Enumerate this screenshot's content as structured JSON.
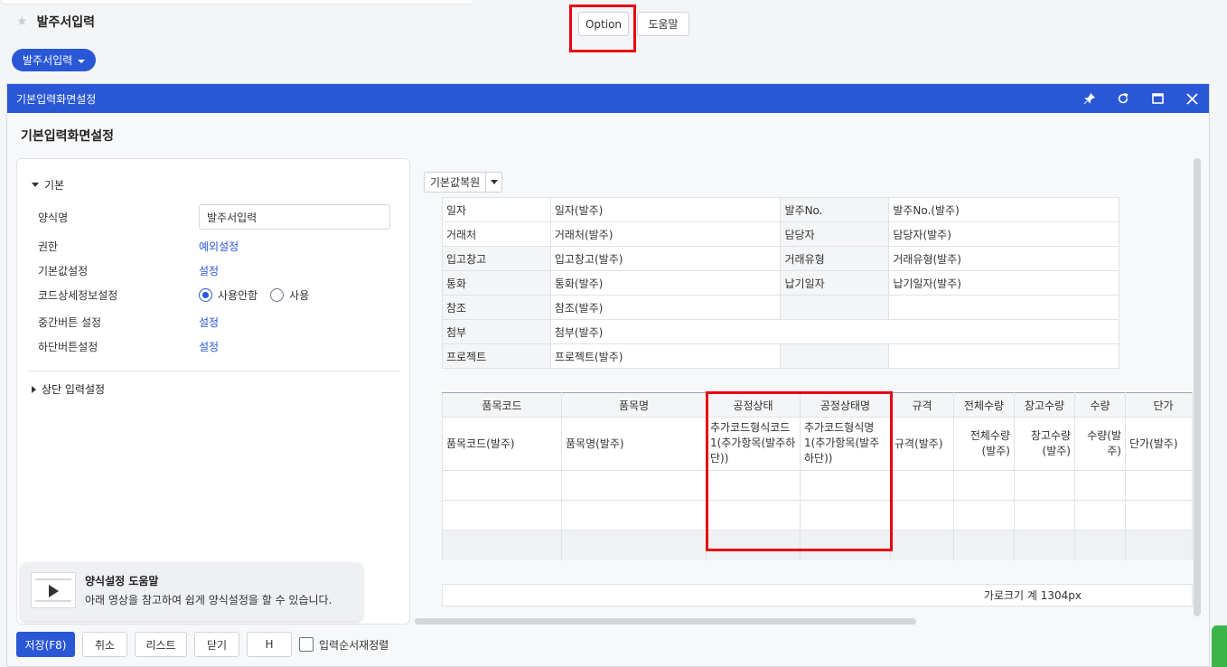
{
  "page": {
    "title": "발주서입력",
    "option_label": "Option",
    "help_label": "도움말",
    "dropdown_label": "발주서입력"
  },
  "modal": {
    "title": "기본입력화면설정",
    "subtitle": "기본입력화면설정",
    "icons": [
      "pin-icon",
      "refresh-icon",
      "maximize-icon",
      "close-icon"
    ]
  },
  "left": {
    "section_basic": "기본",
    "rows": {
      "form_name_label": "양식명",
      "form_name_value": "발주서입력",
      "permission_label": "권한",
      "permission_value": "예외설정",
      "default_label": "기본값설정",
      "default_value": "설정",
      "code_detail_label": "코드상세정보설정",
      "radio_off": "사용안함",
      "radio_on": "사용",
      "mid_button_label": "중간버튼 설정",
      "mid_button_value": "설정",
      "bottom_button_label": "하단버튼설정",
      "bottom_button_value": "설정"
    },
    "section_top": "상단 입력설정",
    "help": {
      "title": "양식설정 도움말",
      "text": "아래 영상을 참고하여 쉽게 양식설정을 할 수 있습니다."
    }
  },
  "right": {
    "reset_label": "기본값복원",
    "header_rows": [
      [
        "일자",
        "일자(발주)",
        "발주No.",
        "발주No.(발주)"
      ],
      [
        "거래처",
        "거래처(발주)",
        "담당자",
        "담당자(발주)"
      ],
      [
        "입고창고",
        "입고창고(발주)",
        "거래유형",
        "거래유형(발주)"
      ],
      [
        "통화",
        "통화(발주)",
        "납기일자",
        "납기일자(발주)"
      ],
      [
        "참조",
        "참조(발주)",
        "",
        ""
      ],
      [
        "첨부",
        "첨부(발주)",
        "",
        ""
      ],
      [
        "프로젝트",
        "프로젝트(발주)",
        "",
        ""
      ]
    ],
    "item_columns": [
      "품목코드",
      "품목명",
      "공정상태",
      "공정상태명",
      "규격",
      "전체수량",
      "창고수량",
      "수량",
      "단가"
    ],
    "item_values": [
      "품목코드(발주)",
      "품목명(발주)",
      "추가코드형식코드1(추가항목(발주하단))",
      "추가코드형식명1(추가항목(발주하단))",
      "규격(발주)",
      "전체수량(발주)",
      "창고수량(발주)",
      "수량(발주)",
      "단가(발주)"
    ],
    "width_total": "가로크기 계 1304px"
  },
  "footer": {
    "save": "저장(F8)",
    "cancel": "취소",
    "list": "리스트",
    "close": "닫기",
    "h": "H",
    "reorder": "입력순서재정렬"
  }
}
